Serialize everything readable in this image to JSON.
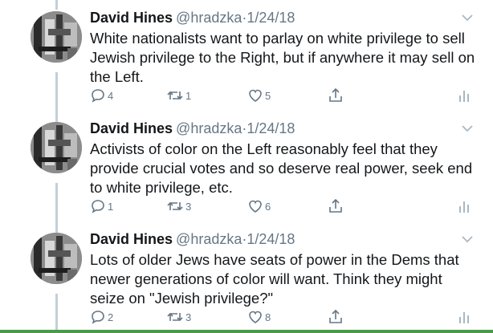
{
  "colors": {
    "text": "#14171a",
    "secondary": "#657786",
    "thread_line": "#c4cfd6",
    "bottom_accent": "#4a9a4a"
  },
  "icons": {
    "reply": "speech-bubble",
    "retweet": "retweet-arrows",
    "like": "heart-outline",
    "share": "share-arrow-up",
    "analytics": "bar-chart",
    "menu": "chevron-down"
  },
  "tweets": [
    {
      "name": "David Hines",
      "handle": "@hradzka",
      "separator": "·",
      "date": "1/24/18",
      "text": "White nationalists want to parlay on white privilege to sell Jewish privilege to the Right, but if anywhere it may sell on the Left.",
      "replies": "4",
      "retweets": "1",
      "likes": "5"
    },
    {
      "name": "David Hines",
      "handle": "@hradzka",
      "separator": "·",
      "date": "1/24/18",
      "text": "Activists of color on the Left reasonably feel that they provide crucial votes and so deserve real power, seek end to white privilege, etc.",
      "replies": "1",
      "retweets": "3",
      "likes": "6"
    },
    {
      "name": "David Hines",
      "handle": "@hradzka",
      "separator": "·",
      "date": "1/24/18",
      "text": "Lots of older Jews have seats of power in the Dems that newer generations of color will want. Think they might seize on \"Jewish privilege?\"",
      "replies": "2",
      "retweets": "3",
      "likes": "8"
    }
  ]
}
